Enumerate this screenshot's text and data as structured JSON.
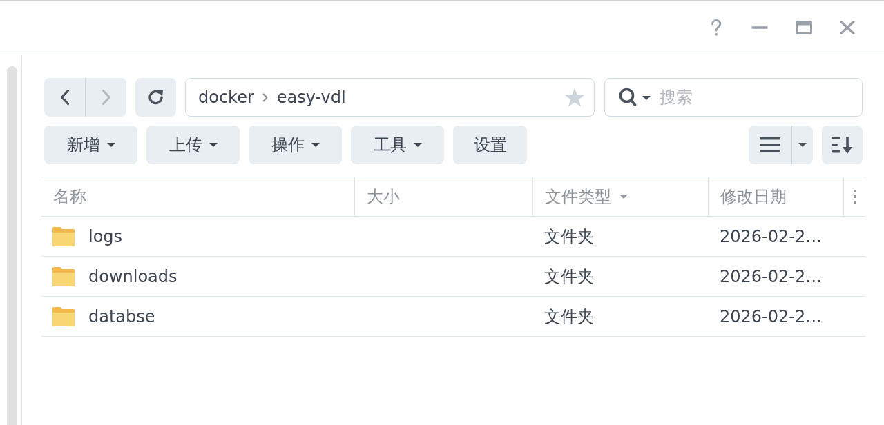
{
  "navigation": {
    "back": {
      "disabled": false
    },
    "forward": {
      "disabled": true
    }
  },
  "path": {
    "segments": [
      "docker",
      "easy-vdl"
    ],
    "favorite": false
  },
  "search": {
    "placeholder": "搜索"
  },
  "toolbar": {
    "buttons": [
      {
        "label": "新增",
        "dropdown": true
      },
      {
        "label": "上传",
        "dropdown": true
      },
      {
        "label": "操作",
        "dropdown": true
      },
      {
        "label": "工具",
        "dropdown": true
      },
      {
        "label": "设置",
        "dropdown": false
      }
    ]
  },
  "table": {
    "columns": [
      {
        "label": "名称",
        "sorted": false
      },
      {
        "label": "大小",
        "sorted": false
      },
      {
        "label": "文件类型",
        "sorted": true
      },
      {
        "label": "修改日期",
        "sorted": false
      }
    ],
    "rows": [
      {
        "kind": "folder",
        "name": "logs",
        "type": "文件夹",
        "modified": "2026-02-2…",
        "selected": false
      },
      {
        "kind": "folder",
        "name": "downloads",
        "type": "文件夹",
        "modified": "2026-02-2…",
        "selected": false
      },
      {
        "kind": "folder",
        "name": "databse",
        "type": "文件夹",
        "modified": "2026-02-2…",
        "selected": false
      }
    ]
  }
}
